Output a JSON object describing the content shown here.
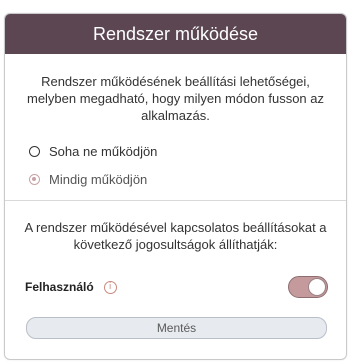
{
  "header": {
    "title": "Rendszer működése"
  },
  "settings": {
    "description": "Rendszer működésének beállítási lehetőségei, melyben megadható, hogy milyen módon fusson az alkalmazás.",
    "options": [
      {
        "label": "Soha ne működjön",
        "selected": false
      },
      {
        "label": "Mindig működjön",
        "selected": true
      }
    ]
  },
  "permissions": {
    "description": "A rendszer működésével kapcsolatos beállításokat a következő jogosultságok állíthatják:",
    "user_label": "Felhasználó",
    "user_enabled": true,
    "info_icon": "info-icon"
  },
  "actions": {
    "save_label": "Mentés"
  },
  "colors": {
    "header_bg": "#5b4652",
    "accent": "#c49a9d",
    "save_bg": "#e7eaef"
  }
}
